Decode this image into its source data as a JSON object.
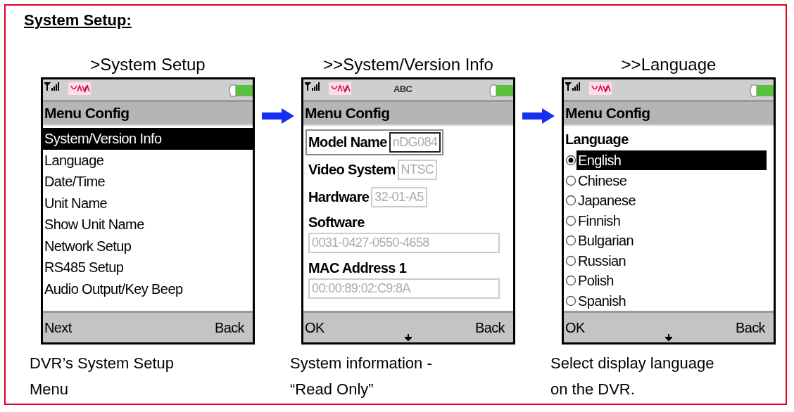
{
  "section_title": "System Setup:",
  "panels": [
    {
      "caption": ">System Setup",
      "screen": {
        "kind": "menu",
        "title": "Menu Config",
        "items": [
          {
            "label": "System/Version Info",
            "selected": true
          },
          {
            "label": "Language",
            "selected": false
          },
          {
            "label": "Date/Time",
            "selected": false
          },
          {
            "label": "Unit Name",
            "selected": false
          },
          {
            "label": "Show Unit Name",
            "selected": false
          },
          {
            "label": "Network Setup",
            "selected": false
          },
          {
            "label": "RS485 Setup",
            "selected": false
          },
          {
            "label": "Audio Output/Key Beep",
            "selected": false
          }
        ],
        "softkeys": {
          "left": "Next",
          "right": "Back"
        },
        "more_below": false
      },
      "description": [
        "DVR’s System Setup",
        "Menu"
      ]
    },
    {
      "caption": ">>System/Version Info",
      "screen": {
        "kind": "info",
        "status_text": "ABC",
        "title": "Menu Config",
        "fields": [
          {
            "label": "Model Name",
            "value": "nDG084",
            "kind": "inline",
            "focused": true
          },
          {
            "label": "Video System",
            "value": "NTSC",
            "kind": "inline",
            "focused": false
          },
          {
            "label": "Hardware",
            "value": "32-01-A5",
            "kind": "inline",
            "focused": false
          },
          {
            "label": "Software",
            "value": "0031-0427-0550-4658",
            "kind": "stacked",
            "focused": false
          },
          {
            "label": "MAC Address 1",
            "value": "00:00:89:02:C9:8A",
            "kind": "stacked",
            "focused": false
          }
        ],
        "softkeys": {
          "left": "OK",
          "right": "Back"
        },
        "more_below": true
      },
      "description": [
        "System information -",
        "“Read Only”"
      ]
    },
    {
      "caption": ">>Language",
      "screen": {
        "kind": "choice",
        "title": "Menu Config",
        "heading": "Language",
        "options": [
          {
            "label": "English",
            "selected": true
          },
          {
            "label": "Chinese",
            "selected": false
          },
          {
            "label": "Japanese",
            "selected": false
          },
          {
            "label": "Finnish",
            "selected": false
          },
          {
            "label": "Bulgarian",
            "selected": false
          },
          {
            "label": "Russian",
            "selected": false
          },
          {
            "label": "Polish",
            "selected": false
          },
          {
            "label": "Spanish",
            "selected": false
          }
        ],
        "softkeys": {
          "left": "OK",
          "right": "Back"
        },
        "more_below": true
      },
      "description": [
        "Select display language",
        "on the DVR."
      ]
    }
  ]
}
